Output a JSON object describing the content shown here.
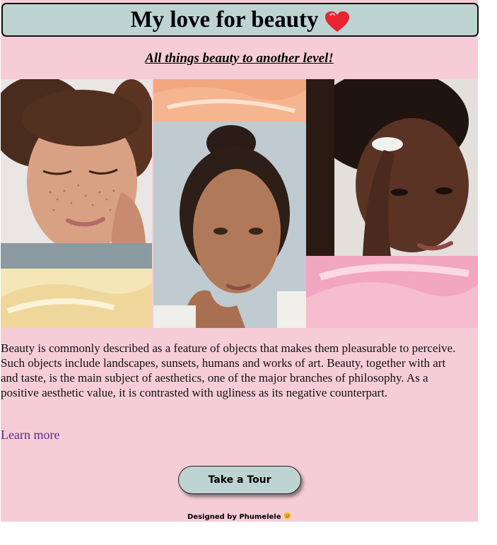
{
  "header": {
    "title": "My love for beauty",
    "title_icon": "red-heart-icon",
    "subtitle": "All things beauty to another level!"
  },
  "collage": {
    "images": [
      {
        "name": "freckled-woman-photo",
        "description": "curly-haired woman with freckles smiling, eyes closed"
      },
      {
        "name": "peach-texture-photo",
        "description": "peach gloss texture"
      },
      {
        "name": "woman-portrait-photo",
        "description": "woman with hair bun, hand on shoulder"
      },
      {
        "name": "cream-texture-photo",
        "description": "yellow cream swatch"
      },
      {
        "name": "skincare-woman-photo",
        "description": "woman applying cream to cheek"
      },
      {
        "name": "pink-texture-photo",
        "description": "pink cream swirl"
      }
    ]
  },
  "main": {
    "description": "Beauty is commonly described as a feature of objects that makes them pleasurable to perceive. Such objects include landscapes, sunsets, humans and works of art. Beauty, together with art and taste, is the main subject of aesthetics, one of the major branches of philosophy. As a positive aesthetic value, it is contrasted with ugliness as its negative counterpart.",
    "learn_more": "Learn more",
    "tour_button": "Take a Tour"
  },
  "footer": {
    "text": "Designed by Phumelele",
    "icon": "smiling-face-icon"
  },
  "colors": {
    "page_background": "#f6cdd7",
    "header_background": "#bed4d3",
    "button_background": "#bed4d3",
    "link": "#5b2b82"
  }
}
